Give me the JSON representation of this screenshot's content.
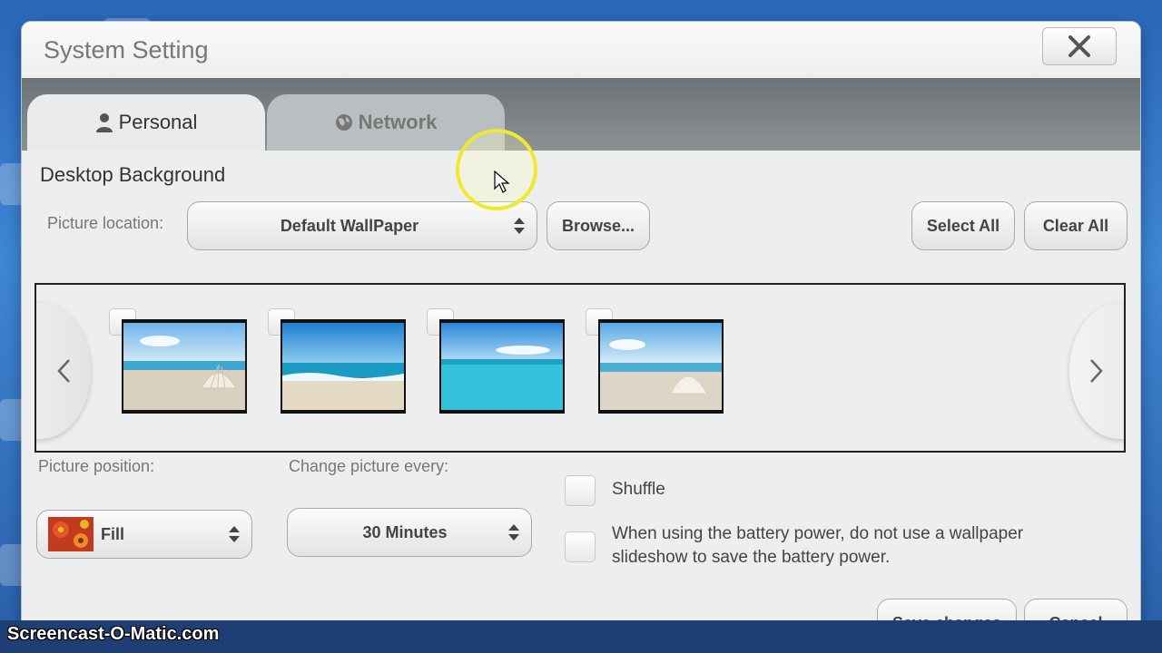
{
  "window": {
    "title": "System Setting"
  },
  "tabs": [
    {
      "label": "Personal",
      "icon": "user-icon",
      "active": true
    },
    {
      "label": "Network",
      "icon": "globe-icon",
      "active": false
    }
  ],
  "desktop_background": {
    "section_title": "Desktop Background",
    "picture_location_label": "Picture location:",
    "picture_location_value": "Default WallPaper",
    "browse_label": "Browse...",
    "select_all_label": "Select All",
    "clear_all_label": "Clear All",
    "thumbnails": [
      {
        "name": "beach-shell",
        "checked": false
      },
      {
        "name": "beach-waves",
        "checked": false
      },
      {
        "name": "turquoise-sea",
        "checked": false
      },
      {
        "name": "beach-shell-2",
        "checked": false
      }
    ]
  },
  "picture_position": {
    "label": "Picture position:",
    "value": "Fill"
  },
  "change_picture": {
    "label": "Change picture every:",
    "value": "30 Minutes"
  },
  "shuffle": {
    "label": "Shuffle",
    "checked": false
  },
  "battery": {
    "line1": "When using the battery power, do not use a wallpaper",
    "line2": "slideshow to save the battery power.",
    "checked": false
  },
  "footer": {
    "save_label": "Save changes",
    "cancel_label": "Cancel"
  },
  "watermark": {
    "text": "Screencast-O-Matic.com"
  },
  "colors": {
    "desktop_blue": "#2b66b8",
    "window_bg": "#eceeef",
    "tab_bar": "#6c7276",
    "highlight_ring": "#eeea33"
  }
}
